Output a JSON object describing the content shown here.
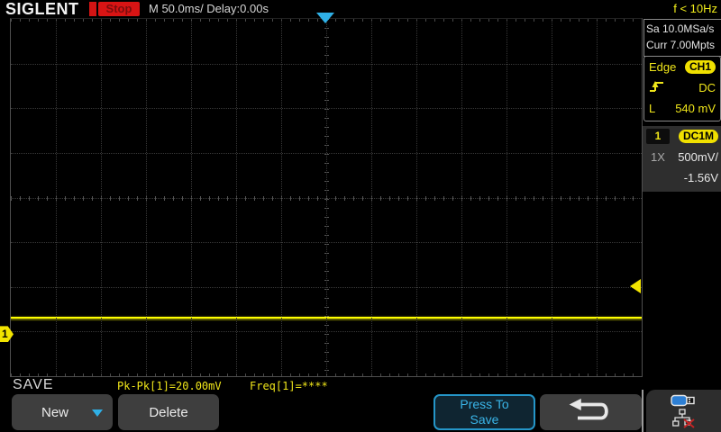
{
  "header": {
    "logo": "SIGLENT",
    "run_state": "Stop",
    "timebase": "M 50.0ms/ Delay:0.00s",
    "freq_counter": "f < 10Hz"
  },
  "acquisition": {
    "sample_rate": "Sa 10.0MSa/s",
    "memory_depth": "Curr 7.00Mpts"
  },
  "trigger": {
    "mode_label": "Edge",
    "source": "CH1",
    "coupling": "DC",
    "level_label": "L",
    "level_value": "540 mV"
  },
  "channel1": {
    "number": "1",
    "coupling_badge": "DC1M",
    "probe": "1X",
    "volts_per_div": "500mV/",
    "offset": "-1.56V"
  },
  "measurements": {
    "pkpk": "Pk-Pk[1]=20.00mV",
    "freq": "Freq[1]=****"
  },
  "menu": {
    "title": "SAVE",
    "new_label": "New",
    "delete_label": "Delete",
    "press_to_save_label": "Press To Save"
  },
  "colors": {
    "accent_yellow": "#f0e61a",
    "trace_yellow": "#ffff00",
    "accent_cyan": "#2fb0e6",
    "stop_red": "#d81414"
  },
  "graticule": {
    "h_divisions": 14,
    "v_divisions": 8
  },
  "waveform": {
    "type": "flat-line",
    "channel": 1,
    "trace_y_frac": 0.8338,
    "ground_marker_y_frac": 0.885,
    "trigger_level_y_frac": 0.7506,
    "trigger_position_x_frac": 0.5,
    "pk_pk": "20.00mV",
    "frequency": "****"
  }
}
